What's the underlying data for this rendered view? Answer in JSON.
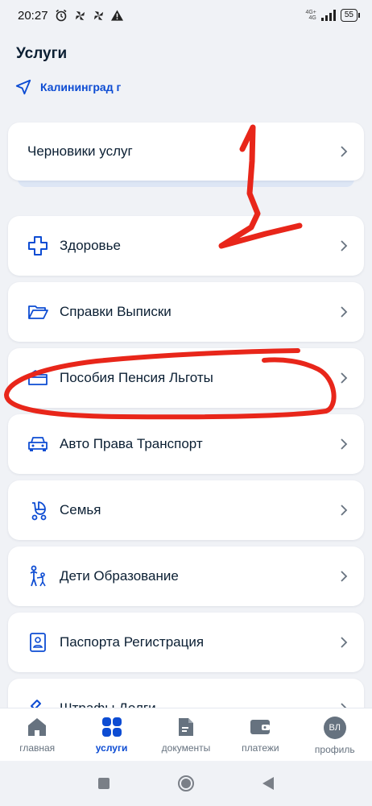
{
  "status": {
    "time": "20:27",
    "net_top": "4G+",
    "net_bottom": "4G",
    "battery": "55"
  },
  "header": {
    "title": "Услуги",
    "location": "Калининград г"
  },
  "drafts": {
    "label": "Черновики услуг"
  },
  "categories": [
    {
      "label": "Здоровье",
      "icon": "medical-cross-icon"
    },
    {
      "label": "Справки Выписки",
      "icon": "folder-open-icon"
    },
    {
      "label": "Пособия Пенсия Льготы",
      "icon": "wallet-icon"
    },
    {
      "label": "Авто Права Транспорт",
      "icon": "car-icon"
    },
    {
      "label": "Семья",
      "icon": "stroller-icon"
    },
    {
      "label": "Дети Образование",
      "icon": "parent-child-icon"
    },
    {
      "label": "Паспорта Регистрация",
      "icon": "passport-icon"
    },
    {
      "label": "Штрафы Долги",
      "icon": "gavel-icon"
    }
  ],
  "nav": {
    "home": "главная",
    "services": "услуги",
    "documents": "документы",
    "payments": "платежи",
    "profile": "профиль",
    "avatar_initials": "ВЛ"
  },
  "colors": {
    "accent": "#0d4cd3",
    "text": "#0b1f33",
    "muted": "#66727f",
    "annotation": "#e8261a",
    "background": "#f0f2f6"
  }
}
